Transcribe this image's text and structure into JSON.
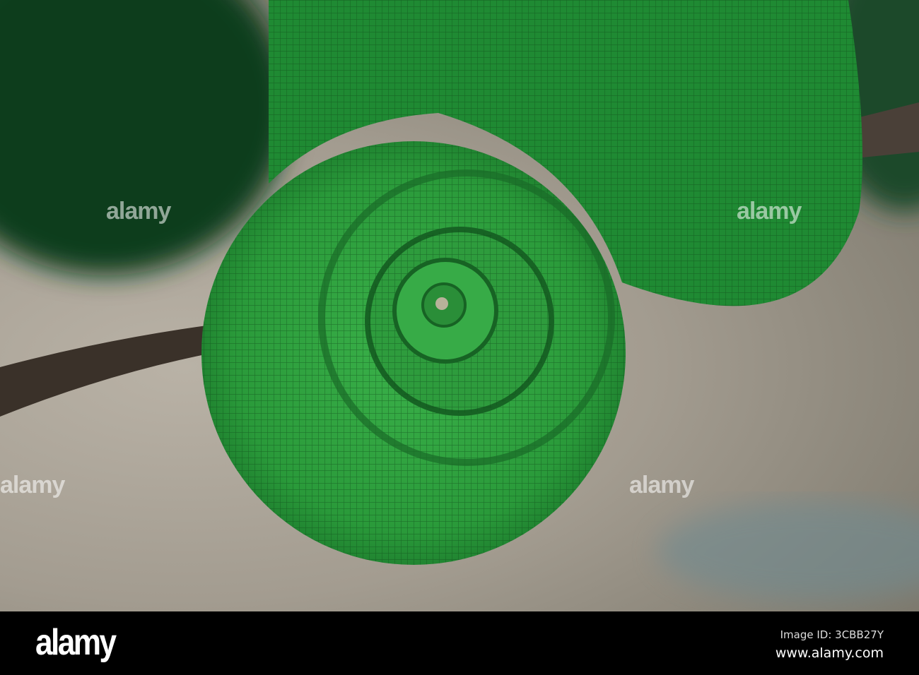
{
  "photo": {
    "subject": "chameleon tail spiral",
    "colors": {
      "tail": "#2fa83c",
      "dark": "#0f4f1c",
      "background": "#aaa397"
    }
  },
  "watermark": {
    "text": "alamy"
  },
  "footer": {
    "logo": "alamy",
    "image_id": "Image ID: 3CBB27Y",
    "url": "www.alamy.com"
  }
}
